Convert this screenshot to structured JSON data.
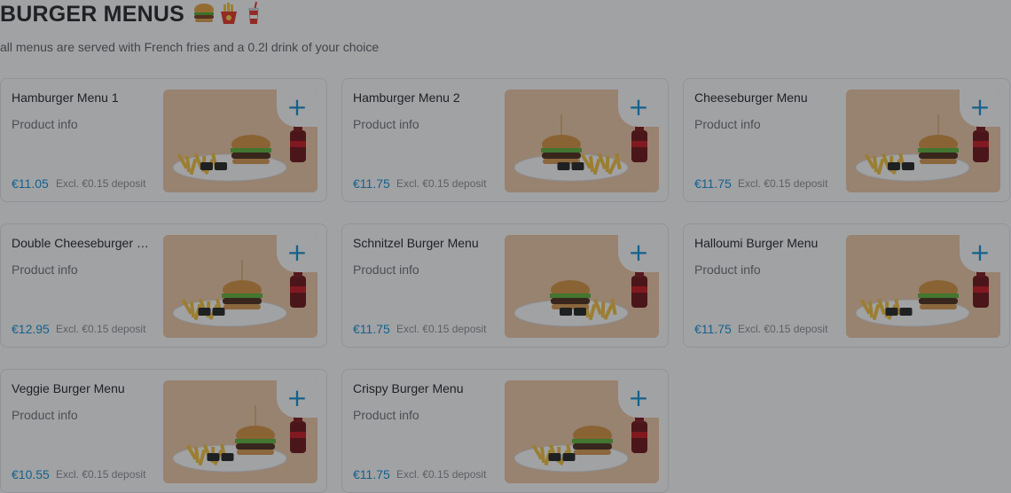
{
  "section": {
    "title": "BURGER MENUS",
    "subtitle": "all menus are served with French fries and a 0.2l drink of your choice"
  },
  "colors": {
    "accent": "#0f8fd6",
    "image_bg": "#f0c9a6",
    "overlay": "rgba(32,33,37,0.42)"
  },
  "icons": [
    "burger-emoji-icon",
    "fries-emoji-icon",
    "drink-emoji-icon",
    "plus-icon"
  ],
  "items": [
    {
      "name": "Hamburger Menu 1",
      "info": "Product info",
      "price": "€11.05",
      "deposit": "Excl. €0.15 deposit"
    },
    {
      "name": "Hamburger Menu 2",
      "info": "Product info",
      "price": "€11.75",
      "deposit": "Excl. €0.15 deposit"
    },
    {
      "name": "Cheeseburger Menu",
      "info": "Product info",
      "price": "€11.75",
      "deposit": "Excl. €0.15 deposit"
    },
    {
      "name": "Double Cheeseburger Menu",
      "info": "Product info",
      "price": "€12.95",
      "deposit": "Excl. €0.15 deposit"
    },
    {
      "name": "Schnitzel Burger Menu",
      "info": "Product info",
      "price": "€11.75",
      "deposit": "Excl. €0.15 deposit"
    },
    {
      "name": "Halloumi Burger Menu",
      "info": "Product info",
      "price": "€11.75",
      "deposit": "Excl. €0.15 deposit"
    },
    {
      "name": "Veggie Burger Menu",
      "info": "Product info",
      "price": "€10.55",
      "deposit": "Excl. €0.15 deposit"
    },
    {
      "name": "Crispy Burger Menu",
      "info": "Product info",
      "price": "€11.75",
      "deposit": "Excl. €0.15 deposit"
    }
  ],
  "add_button_label": "+"
}
